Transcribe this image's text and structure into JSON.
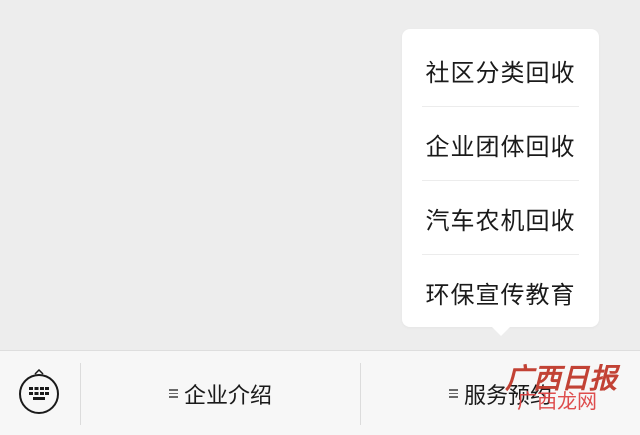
{
  "popup_menu": {
    "items": [
      {
        "label": "社区分类回收"
      },
      {
        "label": "企业团体回收"
      },
      {
        "label": "汽车农机回收"
      },
      {
        "label": "环保宣传教育"
      }
    ]
  },
  "bottom_bar": {
    "keyboard_icon": "keyboard-icon",
    "tabs": [
      {
        "label": "企业介绍",
        "icon": "menu-lines-icon"
      },
      {
        "label": "服务预约",
        "icon": "menu-lines-icon"
      }
    ]
  },
  "watermark": {
    "text": "广西龙网",
    "logo_text": "广西日报"
  },
  "colors": {
    "background": "#ededed",
    "popup": "#ffffff",
    "text": "#1a1a1a",
    "watermark": "#c0392b"
  }
}
